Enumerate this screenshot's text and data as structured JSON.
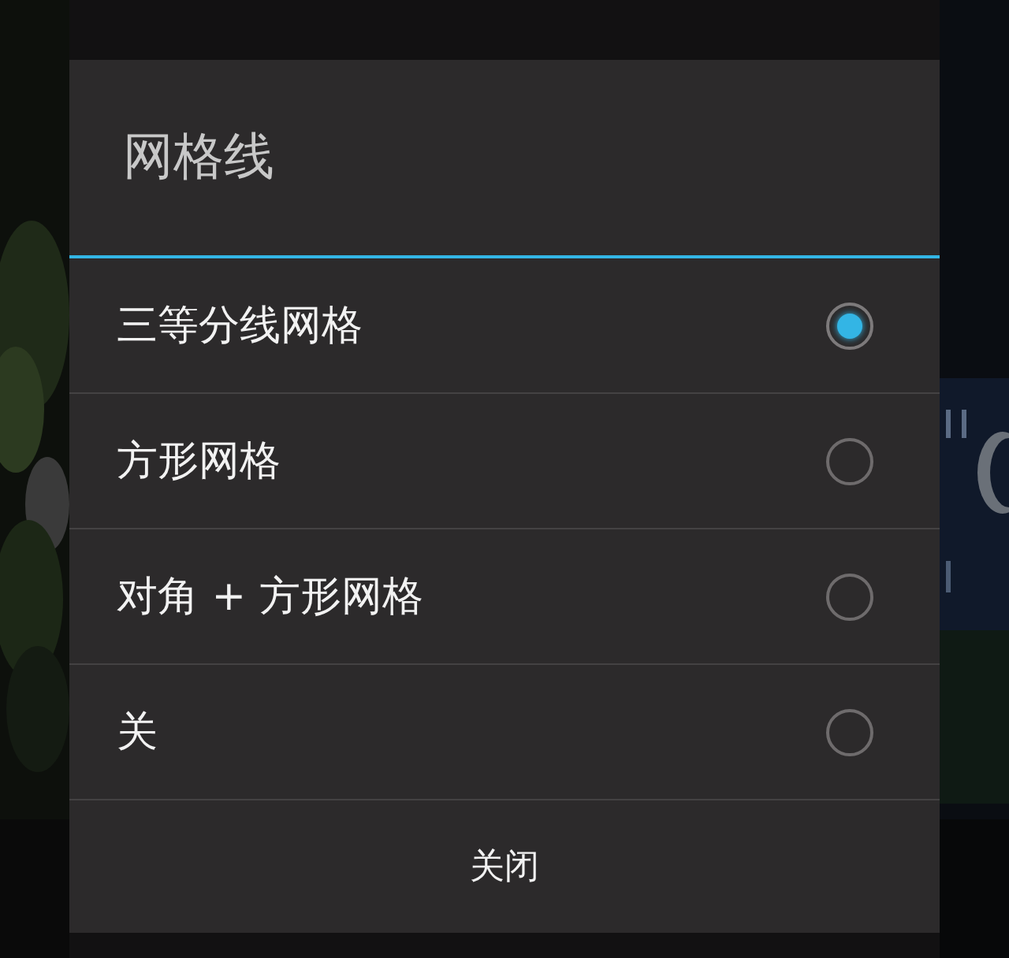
{
  "dialog": {
    "title": "网格线",
    "options": [
      {
        "label": "三等分线网格",
        "selected": true
      },
      {
        "label": "方形网格",
        "selected": false
      },
      {
        "label": "对角 + 方形网格",
        "selected": false
      },
      {
        "label": "关",
        "selected": false
      }
    ],
    "button": "关闭"
  }
}
